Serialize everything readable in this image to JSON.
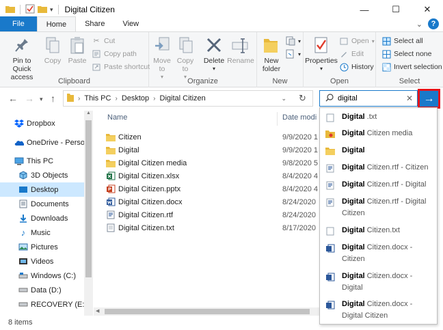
{
  "window": {
    "title": "Digital Citizen",
    "controls": {
      "minimize": "—",
      "maximize": "☐",
      "close": "✕"
    }
  },
  "tabs": [
    {
      "label": "File"
    },
    {
      "label": "Home"
    },
    {
      "label": "Share"
    },
    {
      "label": "View"
    }
  ],
  "ribbon": {
    "clipboard": {
      "label": "Clipboard",
      "pin": "Pin to Quick access",
      "copy": "Copy",
      "paste": "Paste",
      "cut": "Cut",
      "copy_path": "Copy path",
      "paste_shortcut": "Paste shortcut"
    },
    "organize": {
      "label": "Organize",
      "move_to": "Move to",
      "copy_to": "Copy to",
      "delete": "Delete",
      "rename": "Rename"
    },
    "new": {
      "label": "New",
      "new_folder": "New folder"
    },
    "open": {
      "label": "Open",
      "properties": "Properties",
      "open": "Open",
      "edit": "Edit",
      "history": "History"
    },
    "select": {
      "label": "Select",
      "select_all": "Select all",
      "select_none": "Select none",
      "invert": "Invert selection"
    }
  },
  "address": {
    "crumbs": [
      "This PC",
      "Desktop",
      "Digital Citizen"
    ]
  },
  "search": {
    "value": "digital"
  },
  "sidebar": {
    "items": [
      {
        "label": "Dropbox",
        "icon": "dropbox-icon"
      },
      {
        "label": "OneDrive - Person",
        "icon": "onedrive-icon"
      },
      {
        "label": "This PC",
        "icon": "computer-icon"
      },
      {
        "label": "3D Objects",
        "icon": "cube-icon"
      },
      {
        "label": "Desktop",
        "icon": "desktop-icon",
        "selected": true
      },
      {
        "label": "Documents",
        "icon": "documents-icon"
      },
      {
        "label": "Downloads",
        "icon": "download-icon"
      },
      {
        "label": "Music",
        "icon": "music-icon"
      },
      {
        "label": "Pictures",
        "icon": "pictures-icon"
      },
      {
        "label": "Videos",
        "icon": "videos-icon"
      },
      {
        "label": "Windows (C:)",
        "icon": "drive-icon"
      },
      {
        "label": "Data (D:)",
        "icon": "drive-icon"
      },
      {
        "label": "RECOVERY (E:)",
        "icon": "drive-icon"
      }
    ]
  },
  "filelist": {
    "columns": {
      "name": "Name",
      "date": "Date modi"
    },
    "rows": [
      {
        "name": "Citizen",
        "date": "9/9/2020 1",
        "icon": "folder-icon"
      },
      {
        "name": "Digital",
        "date": "9/9/2020 1",
        "icon": "folder-icon"
      },
      {
        "name": "Digital Citizen media",
        "date": "9/8/2020 5",
        "icon": "folder-icon"
      },
      {
        "name": "Digital Citizen.xlsx",
        "date": "8/4/2020 4",
        "icon": "excel-icon"
      },
      {
        "name": "Digital Citizen.pptx",
        "date": "8/4/2020 4",
        "icon": "powerpoint-icon"
      },
      {
        "name": "Digital Citizen.docx",
        "date": "8/24/2020",
        "icon": "word-icon"
      },
      {
        "name": "Digital Citizen.rtf",
        "date": "8/24/2020",
        "icon": "rtf-icon"
      },
      {
        "name": "Digital Citizen.txt",
        "date": "8/17/2020",
        "icon": "txt-icon"
      }
    ]
  },
  "suggestions": [
    {
      "bold": "Digital",
      "rest": " .txt",
      "sub": "",
      "icon": "txt-icon"
    },
    {
      "bold": "Digital",
      "rest": " Citizen media",
      "sub": "",
      "icon": "folder-media-icon"
    },
    {
      "bold": "Digital",
      "rest": "",
      "sub": "",
      "icon": "folder-icon"
    },
    {
      "bold": "Digital",
      "rest": " Citizen.rtf",
      "sub": " - Citizen",
      "icon": "rtf-icon"
    },
    {
      "bold": "Digital",
      "rest": " Citizen.rtf",
      "sub": " - Digital",
      "icon": "rtf-icon"
    },
    {
      "bold": "Digital",
      "rest": " Citizen.rtf",
      "sub": " - Digital Citizen",
      "icon": "rtf-icon"
    },
    {
      "bold": "Digital",
      "rest": " Citizen.txt",
      "sub": "",
      "icon": "txt-icon"
    },
    {
      "bold": "Digital",
      "rest": " Citizen.docx",
      "sub": " - Citizen",
      "icon": "word-icon"
    },
    {
      "bold": "Digital",
      "rest": " Citizen.docx",
      "sub": " - Digital",
      "icon": "word-icon"
    },
    {
      "bold": "Digital",
      "rest": " Citizen.docx",
      "sub": " - Digital Citizen",
      "icon": "word-icon"
    }
  ],
  "status": {
    "items": "8 items"
  },
  "colors": {
    "accent": "#1979ca",
    "highlight": "#e5141b",
    "selection": "#cce8ff"
  }
}
